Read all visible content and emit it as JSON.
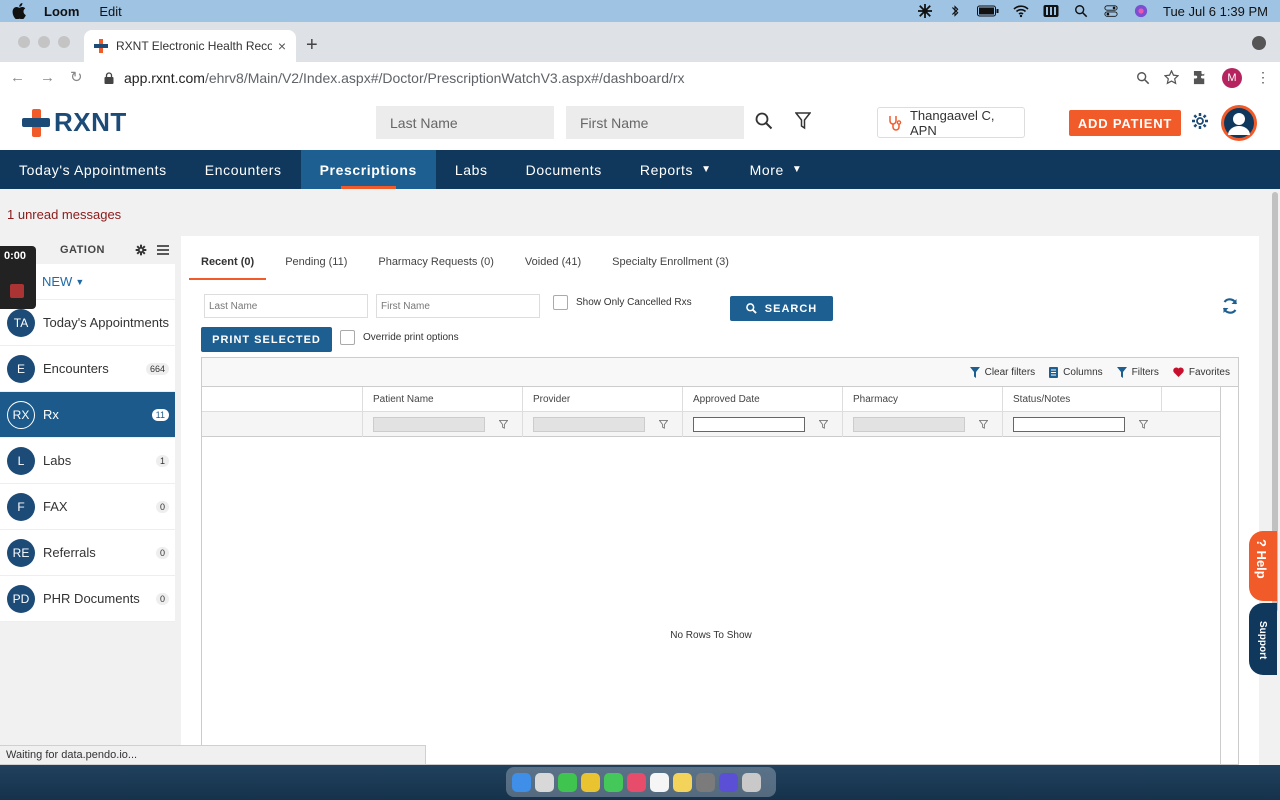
{
  "menubar": {
    "app_name": "Loom",
    "menu_edit": "Edit",
    "datetime": "Tue Jul 6  1:39 PM"
  },
  "browser": {
    "tab_title": "RXNT Electronic Health Record",
    "tab_close": "×",
    "new_tab": "+",
    "url_host": "app.rxnt.com",
    "url_path": "/ehrv8/Main/V2/Index.aspx#/Doctor/PrescriptionWatchV3.aspx#/dashboard/rx",
    "profile_initial": "M"
  },
  "header": {
    "logo_text": "RXNT",
    "last_name_placeholder": "Last Name",
    "first_name_placeholder": "First Name",
    "provider": "Thangaavel C, APN",
    "add_patient": "ADD PATIENT"
  },
  "mainnav": {
    "items": [
      {
        "label": "Today's Appointments"
      },
      {
        "label": "Encounters"
      },
      {
        "label": "Prescriptions"
      },
      {
        "label": "Labs"
      },
      {
        "label": "Documents"
      },
      {
        "label": "Reports"
      },
      {
        "label": "More"
      }
    ],
    "active": "Prescriptions"
  },
  "unread_messages": "1 unread messages",
  "leftpanel": {
    "heading": "GATION",
    "new_label": "NEW",
    "items": [
      {
        "initials": "TA",
        "label": "Today's Appointments",
        "count": ""
      },
      {
        "initials": "E",
        "label": "Encounters",
        "count": "664"
      },
      {
        "initials": "RX",
        "label": "Rx",
        "count": "11"
      },
      {
        "initials": "L",
        "label": "Labs",
        "count": "1"
      },
      {
        "initials": "F",
        "label": "FAX",
        "count": "0"
      },
      {
        "initials": "RE",
        "label": "Referrals",
        "count": "0"
      },
      {
        "initials": "PD",
        "label": "PHR Documents",
        "count": "0"
      }
    ]
  },
  "recorder": {
    "time": "0:00"
  },
  "subtabs": {
    "items": [
      {
        "label": "Recent (0)"
      },
      {
        "label": "Pending (11)"
      },
      {
        "label": "Pharmacy Requests (0)"
      },
      {
        "label": "Voided (41)"
      },
      {
        "label": "Specialty Enrollment (3)"
      }
    ]
  },
  "filters": {
    "last_name_placeholder": "Last Name",
    "first_name_placeholder": "First Name",
    "cancelled_label": "Show Only Cancelled Rxs",
    "search_label": "SEARCH",
    "print_selected": "PRINT SELECTED",
    "override_label": "Override print options"
  },
  "grid": {
    "toolbar": {
      "clear_filters": "Clear filters",
      "columns": "Columns",
      "filters": "Filters",
      "favorites": "Favorites"
    },
    "columns": [
      "Patient Name",
      "Provider",
      "Approved Date",
      "Pharmacy",
      "Status/Notes"
    ],
    "empty_text": "No Rows To Show"
  },
  "side_tabs": {
    "help": "? Help",
    "support": "Support"
  },
  "status_text": "Waiting for data.pendo.io...",
  "colors": {
    "brand_navy": "#10385c",
    "brand_orange": "#f15a29",
    "active_blue": "#1d5f90"
  }
}
